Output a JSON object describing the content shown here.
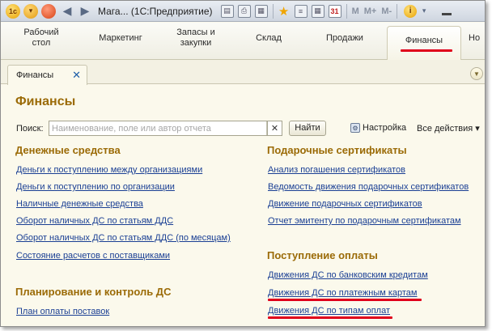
{
  "window": {
    "title": "Мага...  (1С:Предприятие)",
    "m_buttons": [
      "M",
      "M+",
      "M-"
    ]
  },
  "sections": [
    {
      "label": "Рабочий стол"
    },
    {
      "label": "Маркетинг"
    },
    {
      "label": "Запасы и закупки"
    },
    {
      "label": "Склад"
    },
    {
      "label": "Продажи"
    },
    {
      "label": "Финансы",
      "active": true
    },
    {
      "label": "Но"
    }
  ],
  "tab": {
    "label": "Финансы",
    "close": "✕"
  },
  "page": {
    "title": "Финансы"
  },
  "search": {
    "label": "Поиск:",
    "placeholder": "Наименование, поле или автор отчета",
    "find_button": "Найти",
    "settings": "Настройка",
    "all_actions": "Все действия ▾"
  },
  "groups": {
    "cash": {
      "title": "Денежные средства",
      "links": [
        "Деньги к поступлению между организациями",
        "Деньги к поступлению по организации",
        "Наличные денежные средства",
        "Оборот наличных ДС по статьям ДДС",
        "Оборот наличных ДС по статьям ДДС (по месяцам)",
        "Состояние расчетов с поставщиками"
      ]
    },
    "planning": {
      "title": "Планирование и контроль ДС",
      "links": [
        "План оплаты поставок"
      ]
    },
    "gift": {
      "title": "Подарочные сертификаты",
      "links": [
        "Анализ погашения сертификатов",
        "Ведомость движения подарочных сертификатов",
        "Движение подарочных сертификатов",
        "Отчет эмитенту по подарочным сертификатам"
      ]
    },
    "payment": {
      "title": "Поступление оплаты",
      "links": [
        "Движения ДС по банковским кредитам",
        "Движения ДС по платежным картам",
        "Движения ДС по типам оплат"
      ]
    }
  },
  "colors": {
    "accent_heading": "#9b6b07",
    "link": "#1a3f94",
    "highlight": "#e0001b"
  }
}
